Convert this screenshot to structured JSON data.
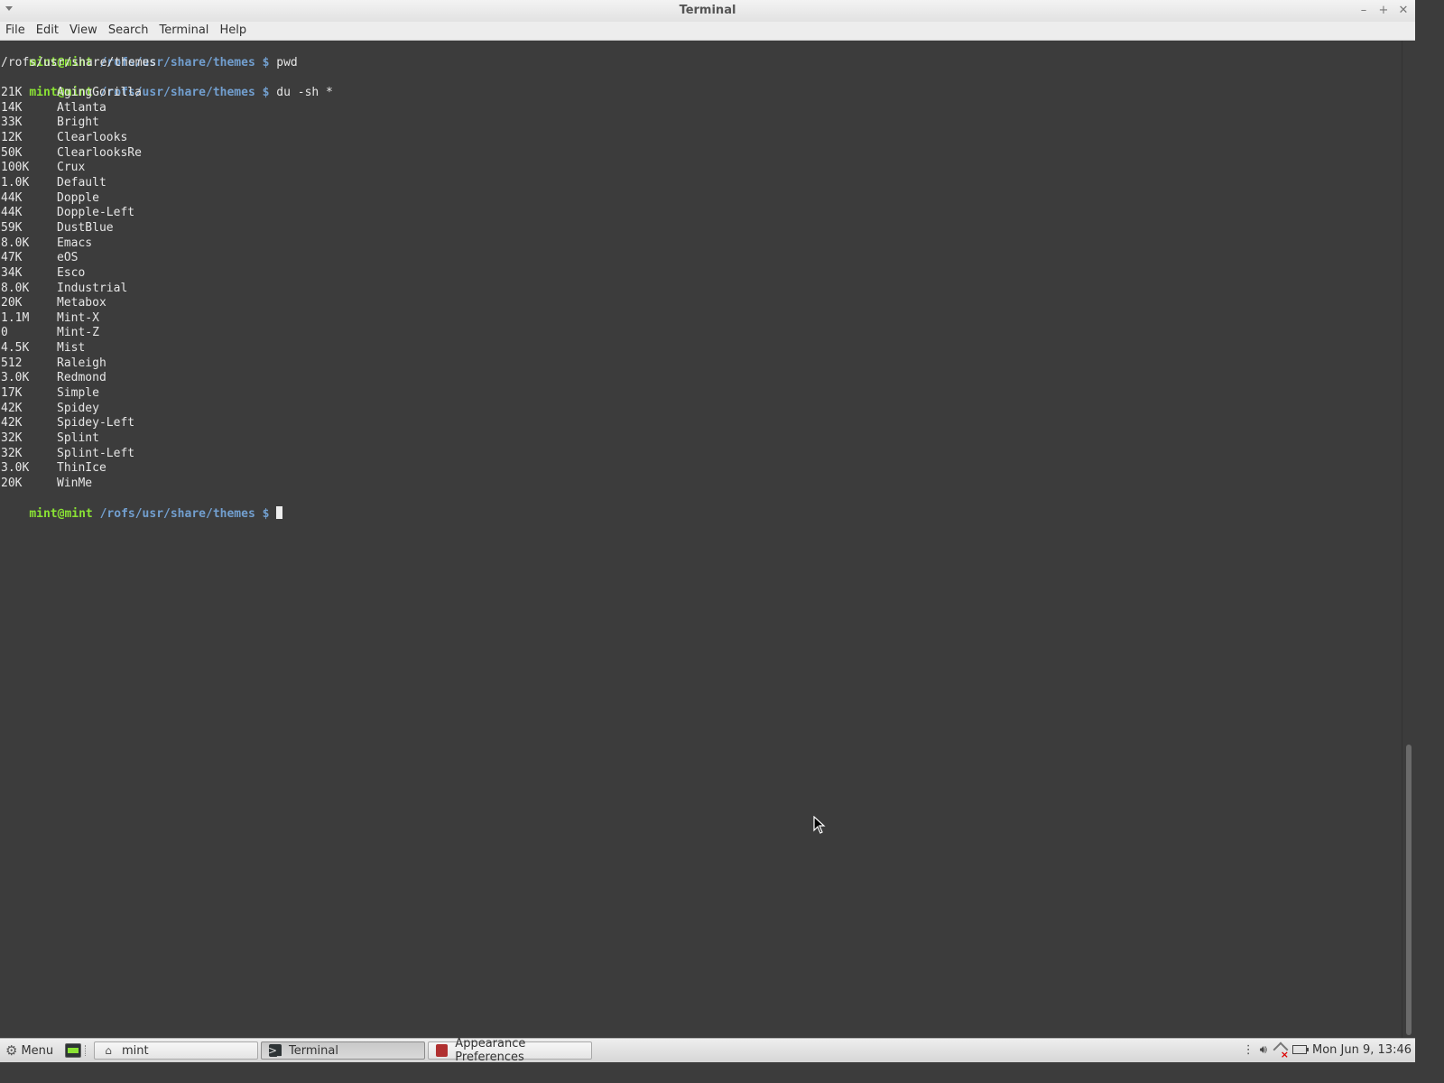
{
  "window": {
    "title": "Terminal",
    "controls": {
      "minimize": "–",
      "maximize": "+",
      "close": "✕"
    }
  },
  "menubar": [
    "File",
    "Edit",
    "View",
    "Search",
    "Terminal",
    "Help"
  ],
  "terminal": {
    "prompt_user": "mint@mint",
    "prompt_path": "/rofs/usr/share/themes",
    "prompt_symbol": "$",
    "commands": [
      "pwd",
      "du -sh *"
    ],
    "pwd_output": "/rofs/usr/share/themes",
    "du_output": [
      {
        "size": "21K",
        "name": "AgingGorilla"
      },
      {
        "size": "14K",
        "name": "Atlanta"
      },
      {
        "size": "33K",
        "name": "Bright"
      },
      {
        "size": "12K",
        "name": "Clearlooks"
      },
      {
        "size": "50K",
        "name": "ClearlooksRe"
      },
      {
        "size": "100K",
        "name": "Crux"
      },
      {
        "size": "1.0K",
        "name": "Default"
      },
      {
        "size": "44K",
        "name": "Dopple"
      },
      {
        "size": "44K",
        "name": "Dopple-Left"
      },
      {
        "size": "59K",
        "name": "DustBlue"
      },
      {
        "size": "8.0K",
        "name": "Emacs"
      },
      {
        "size": "47K",
        "name": "eOS"
      },
      {
        "size": "34K",
        "name": "Esco"
      },
      {
        "size": "8.0K",
        "name": "Industrial"
      },
      {
        "size": "20K",
        "name": "Metabox"
      },
      {
        "size": "1.1M",
        "name": "Mint-X"
      },
      {
        "size": "0",
        "name": "Mint-Z"
      },
      {
        "size": "4.5K",
        "name": "Mist"
      },
      {
        "size": "512",
        "name": "Raleigh"
      },
      {
        "size": "3.0K",
        "name": "Redmond"
      },
      {
        "size": "17K",
        "name": "Simple"
      },
      {
        "size": "42K",
        "name": "Spidey"
      },
      {
        "size": "42K",
        "name": "Spidey-Left"
      },
      {
        "size": "32K",
        "name": "Splint"
      },
      {
        "size": "32K",
        "name": "Splint-Left"
      },
      {
        "size": "3.0K",
        "name": "ThinIce"
      },
      {
        "size": "20K",
        "name": "WinMe"
      }
    ]
  },
  "taskbar": {
    "menu_label": "Menu",
    "tasks": [
      {
        "label": "mint",
        "icon": "home-icon",
        "active": false
      },
      {
        "label": "Terminal",
        "icon": "terminal-icon",
        "active": true
      },
      {
        "label": "Appearance Preferences",
        "icon": "appearance-icon",
        "active": false
      }
    ],
    "clock": "Mon Jun  9, 13:46"
  },
  "colors": {
    "terminal_bg": "#3c3c3c",
    "terminal_fg": "#e6e6e6",
    "prompt_user": "#8ae234",
    "prompt_path": "#729fcf"
  }
}
